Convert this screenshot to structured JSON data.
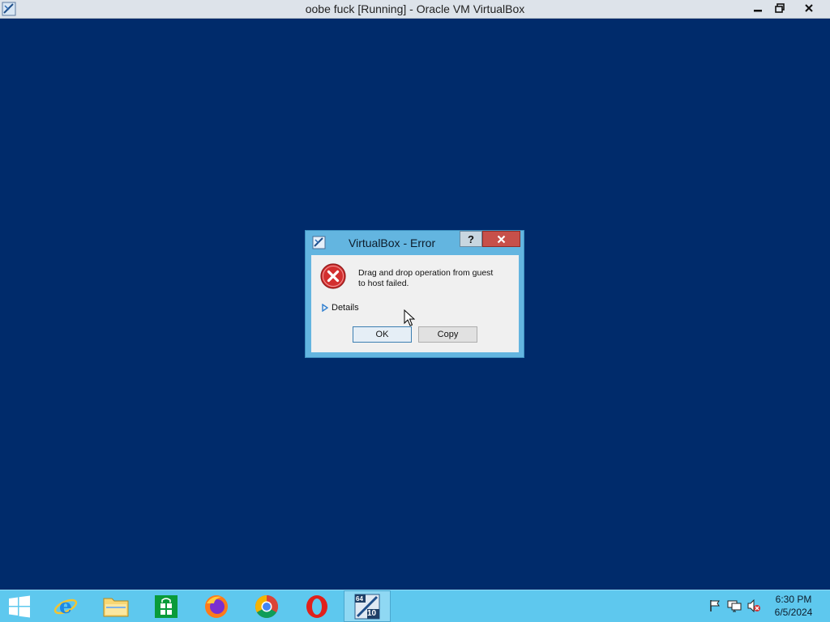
{
  "window": {
    "title": "oobe fuck [Running] - Oracle VM VirtualBox"
  },
  "dialog": {
    "title": "VirtualBox - Error",
    "help_label": "?",
    "message_line1": "Drag and drop operation from guest",
    "message_line2": "to host failed.",
    "details_label": "Details",
    "ok_label": "OK",
    "copy_label": "Copy"
  },
  "taskbar": {
    "apps": [
      "start",
      "internet-explorer",
      "file-explorer",
      "store",
      "firefox",
      "chrome",
      "opera",
      "virtualbox"
    ],
    "vbox_badge_top": "64",
    "vbox_badge_bottom": "10",
    "time": "6:30 PM",
    "date": "6/5/2024"
  },
  "colors": {
    "desktop": "#002b6b",
    "taskbar": "#5ec8ee",
    "dialog_frame": "#63b5e0",
    "close_button": "#c7504a",
    "error_red": "#d32f2f"
  }
}
